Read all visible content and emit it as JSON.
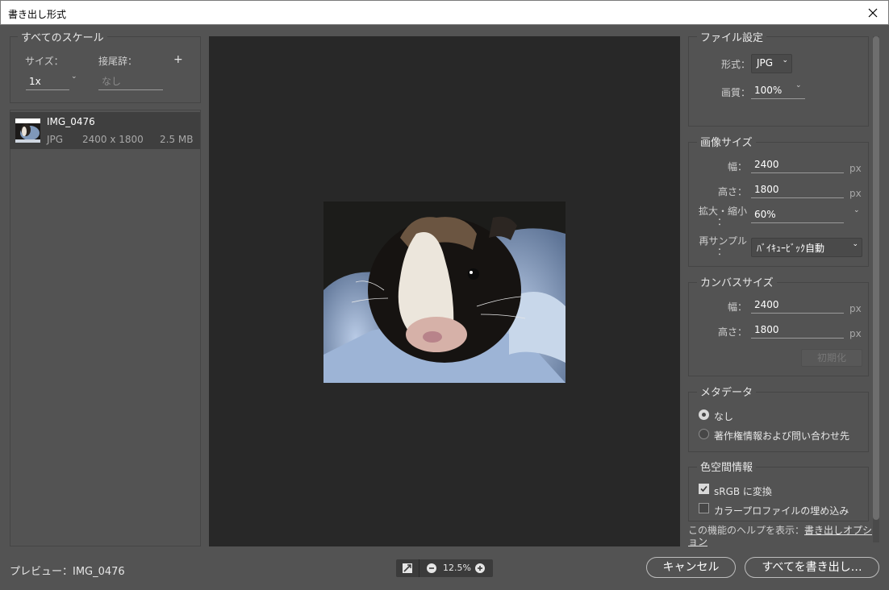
{
  "window": {
    "title": "書き出し形式",
    "close_icon": "close-icon"
  },
  "left_panel": {
    "legend": "すべてのスケール",
    "size_label": "サイズ：",
    "suffix_label": "接尾辞：",
    "add_icon": "+",
    "size_value": "1x",
    "suffix_placeholder": "なし",
    "file": {
      "name": "IMG_0476",
      "format": "JPG",
      "dimensions": "2400 x 1800",
      "filesize": "2.5 MB"
    }
  },
  "file_settings": {
    "legend": "ファイル設定",
    "format_label": "形式：",
    "format_value": "JPG",
    "quality_label": "画質：",
    "quality_value": "100%"
  },
  "image_size": {
    "legend": "画像サイズ",
    "width_label": "幅：",
    "width_value": "2400",
    "height_label": "高さ：",
    "height_value": "1800",
    "scale_label_line1": "拡大・縮小",
    "scale_label_line2": "：",
    "scale_value": "60%",
    "resample_label_line1": "再サンプル",
    "resample_label_line2": "：",
    "resample_value": "ﾊﾞｲｷｭｰﾋﾞｯｸ自動",
    "unit": "px"
  },
  "canvas_size": {
    "legend": "カンバスサイズ",
    "width_label": "幅：",
    "width_value": "2400",
    "height_label": "高さ：",
    "height_value": "1800",
    "reset_label": "初期化",
    "unit": "px"
  },
  "metadata": {
    "legend": "メタデータ",
    "options": [
      "なし",
      "著作権情報および問い合わせ先"
    ],
    "selected": 0
  },
  "color_space": {
    "legend": "色空間情報",
    "convert_srgb_label": "sRGB に変換",
    "convert_srgb_checked": true,
    "embed_profile_label": "カラープロファイルの埋め込み",
    "embed_profile_checked": false
  },
  "help": {
    "prefix": "この機能のヘルプを表示：",
    "link": "書き出しオプション"
  },
  "footer": {
    "preview_label": "プレビュー：IMG_0476",
    "zoom_value": "12.5%",
    "cancel_label": "キャンセル",
    "export_all_label": "すべてを書き出し…"
  }
}
